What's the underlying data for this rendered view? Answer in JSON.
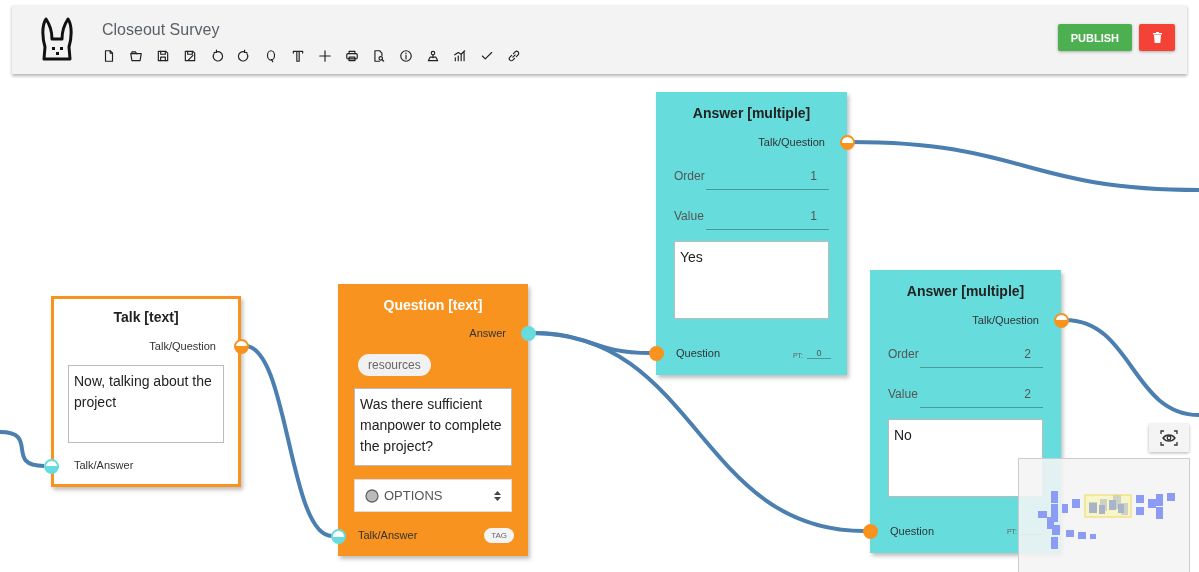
{
  "app": {
    "title": "Closeout Survey"
  },
  "actions": [
    {
      "kind": "publish",
      "label": "PUBLISH"
    },
    {
      "kind": "delete"
    }
  ],
  "nodes": [
    {
      "kind": "talk",
      "title": "Talk [text]",
      "out_port": {
        "label": "Talk/Question",
        "kind": "half",
        "color": "#f7931e"
      },
      "text": "Now, talking about the project",
      "in_port": {
        "label": "Talk/Answer",
        "kind": "half",
        "color": "#66dcdc"
      }
    },
    {
      "kind": "question",
      "title": "Question [text]",
      "out_port": {
        "label": "Answer",
        "kind": "full",
        "color": "#66dcdc"
      },
      "chip": "resources",
      "text": "Was there sufficient manpower to complete the project?",
      "select": "OPTIONS",
      "in_port": {
        "label": "Talk/Answer",
        "kind": "half",
        "color": "#66dcdc"
      },
      "tag": "TAG"
    },
    {
      "kind": "answer",
      "title": "Answer [multiple]",
      "out_port": {
        "label": "Talk/Question",
        "kind": "half",
        "color": "#f7931e"
      },
      "fields": [
        {
          "label": "Order",
          "value": "1"
        },
        {
          "label": "Value",
          "value": "1"
        }
      ],
      "text": "Yes",
      "in_port": {
        "label": "Question",
        "kind": "full",
        "color": "#f7931e"
      },
      "pt": {
        "label": "PT:",
        "value": "0"
      }
    },
    {
      "kind": "answer",
      "title": "Answer [multiple]",
      "out_port": {
        "label": "Talk/Question",
        "kind": "half",
        "color": "#f7931e"
      },
      "fields": [
        {
          "label": "Order",
          "value": "2"
        },
        {
          "label": "Value",
          "value": "2"
        }
      ],
      "text": "No",
      "in_port": {
        "label": "Question",
        "kind": "full",
        "color": "#f7931e"
      },
      "pt": {
        "label": "PT:"
      }
    }
  ]
}
